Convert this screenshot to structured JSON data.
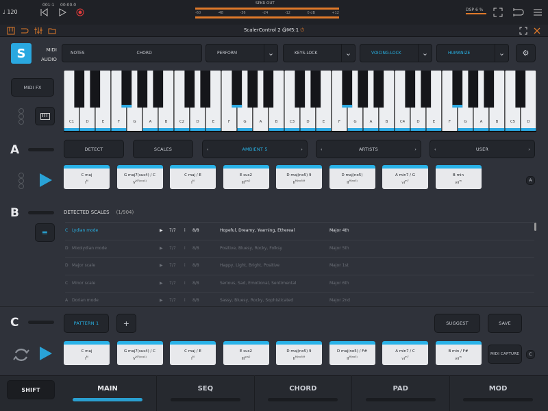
{
  "transport": {
    "tempo": "120",
    "bars": "001:1",
    "time": "00:00.0"
  },
  "meter": {
    "label": "SPKR OUT",
    "ticks": [
      "-60",
      "-48",
      "-36",
      "-24",
      "-12",
      "0 dB",
      "+12"
    ]
  },
  "dsp": {
    "label": "DSP",
    "value": "6 %"
  },
  "plugin_title": "ScalerControl 2 @M5:1",
  "midi_audio": {
    "midi": "MIDI",
    "audio": "AUDIO"
  },
  "mode_selector": {
    "notes": "NOTES",
    "chord": "CHORD"
  },
  "dropdowns": [
    {
      "label": "PERFORM",
      "active": false
    },
    {
      "label": "KEYS-LOCK",
      "active": false
    },
    {
      "label": "VOICING-LOCK",
      "active": true
    },
    {
      "label": "HUMANIZE",
      "active": true
    }
  ],
  "midi_fx": "MIDI FX",
  "keyboard": {
    "white_keys": [
      "C1",
      "D",
      "E",
      "F",
      "G",
      "A",
      "B",
      "C2",
      "D",
      "E",
      "F",
      "G",
      "A",
      "B",
      "C3",
      "D",
      "E",
      "F",
      "G",
      "A",
      "B",
      "C4",
      "D",
      "E",
      "F",
      "G",
      "A",
      "B",
      "C5",
      "D"
    ]
  },
  "section_a": {
    "letter": "A",
    "detect": "DETECT",
    "scales": "SCALES",
    "preset": "AMBIENT 5",
    "artists": "ARTISTS",
    "user": "USER",
    "side_badge": "A",
    "chords": [
      {
        "name": "C maj",
        "degree": "I",
        "sup": "M"
      },
      {
        "name": "G maj7(sus4) / C",
        "degree": "V",
        "sup": "M7(sus4)"
      },
      {
        "name": "C maj / E",
        "degree": "I",
        "sup": "M"
      },
      {
        "name": "E sus2",
        "degree": "III",
        "sup": "sus2"
      },
      {
        "name": "D maj(no5) 9",
        "degree": "II",
        "sup": "M(no5)9"
      },
      {
        "name": "D maj(no5)",
        "degree": "II",
        "sup": "M(no5)"
      },
      {
        "name": "A min7 / G",
        "degree": "vi",
        "sup": "m7"
      },
      {
        "name": "B min",
        "degree": "vii",
        "sup": "m"
      }
    ]
  },
  "section_b": {
    "letter": "B",
    "title": "DETECTED SCALES",
    "count": "(1/904)",
    "rows": [
      {
        "idx": "C",
        "name": "Lydian mode",
        "a": "7/7",
        "b": "8/8",
        "moods": "Hopeful, Dreamy, Yearning, Ethereal",
        "rel": "Major 4th",
        "active": true
      },
      {
        "idx": "D",
        "name": "Mixolydian mode",
        "a": "7/7",
        "b": "8/8",
        "moods": "Positive, Bluesy, Rocky, Folksy",
        "rel": "Major 5th",
        "active": false
      },
      {
        "idx": "D",
        "name": "Major scale",
        "a": "7/7",
        "b": "8/8",
        "moods": "Happy, Light, Bright, Positive",
        "rel": "Major 1st",
        "active": false
      },
      {
        "idx": "C",
        "name": "Minor scale",
        "a": "7/7",
        "b": "8/8",
        "moods": "Serious, Sad, Emotional, Sentimental",
        "rel": "Major 6th",
        "active": false
      },
      {
        "idx": "A",
        "name": "Dorian mode",
        "a": "7/7",
        "b": "8/8",
        "moods": "Sassy, Bluesy, Rocky, Sophisticated",
        "rel": "Major 2nd",
        "active": false
      }
    ]
  },
  "section_c": {
    "letter": "C",
    "pattern": "PATTERN 1",
    "add": "+",
    "suggest": "SUGGEST",
    "save": "SAVE",
    "midi_capture": "MIDI CAPTURE",
    "side_badge": "C",
    "chords": [
      {
        "name": "C maj",
        "degree": "I",
        "sup": "M"
      },
      {
        "name": "G maj7(sus4) / C",
        "degree": "V",
        "sup": "M7(sus4)"
      },
      {
        "name": "C maj / E",
        "degree": "I",
        "sup": "M"
      },
      {
        "name": "E sus2",
        "degree": "III",
        "sup": "sus2"
      },
      {
        "name": "D maj(no5) 9",
        "degree": "II",
        "sup": "M(no5)9"
      },
      {
        "name": "D maj(no5) / F#",
        "degree": "II",
        "sup": "M(no5)"
      },
      {
        "name": "A min7 / C",
        "degree": "vi",
        "sup": "m7"
      },
      {
        "name": "B min / F#",
        "degree": "vii",
        "sup": "m"
      }
    ]
  },
  "bottom": {
    "shift": "SHIFT",
    "tabs": [
      {
        "label": "MAIN",
        "active": true
      },
      {
        "label": "SEQ",
        "active": false
      },
      {
        "label": "CHORD",
        "active": false
      },
      {
        "label": "PAD",
        "active": false
      },
      {
        "label": "MOD",
        "active": false
      }
    ]
  },
  "colors": {
    "accent": "#29b2e8",
    "record": "#e23b3b",
    "orange": "#e07a2a"
  }
}
